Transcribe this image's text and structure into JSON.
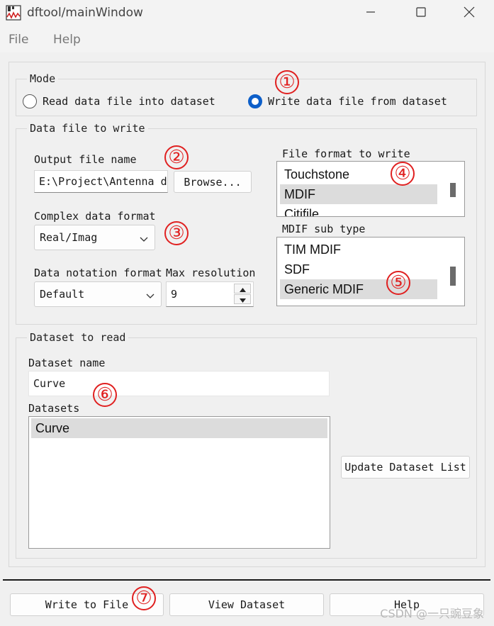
{
  "window": {
    "title": "dftool/mainWindow"
  },
  "menu": {
    "file": "File",
    "help": "Help"
  },
  "mode": {
    "legend": "Mode",
    "read_label": "Read data file into dataset",
    "write_label": "Write data file from dataset",
    "selected": "write"
  },
  "write_group": {
    "legend": "Data file to write",
    "output_label": "Output file name",
    "output_value": "E:\\Project\\Antenna design",
    "browse_label": "Browse...",
    "complex_label": "Complex data format",
    "complex_value": "Real/Imag",
    "notation_label": "Data notation format",
    "notation_value": "Default",
    "maxres_label": "Max resolution",
    "maxres_value": "9",
    "format_label": "File format to write",
    "format_items": [
      "Touchstone",
      "MDIF",
      "Citifile"
    ],
    "format_selected": 1,
    "subtype_label": "MDIF sub type",
    "subtype_items": [
      "TIM MDIF",
      "SDF",
      "Generic MDIF"
    ],
    "subtype_selected": 2
  },
  "read_group": {
    "legend": "Dataset to read",
    "name_label": "Dataset name",
    "name_value": "Curve",
    "datasets_label": "Datasets",
    "datasets": [
      "Curve"
    ],
    "update_label": "Update Dataset List"
  },
  "footer": {
    "write_button": "Write to File",
    "view_button": "View Dataset",
    "help_button": "Help"
  },
  "annotations": [
    "①",
    "②",
    "③",
    "④",
    "⑤",
    "⑥",
    "⑦"
  ],
  "watermark": "CSDN @一只豌豆象",
  "colors": {
    "accent": "#0d5fc9",
    "annotation": "#e02020",
    "selection": "#dcdcdc"
  },
  "icons": {
    "app": "waveform-app-icon",
    "minimize": "minimize-icon",
    "maximize": "maximize-icon",
    "close": "close-icon"
  }
}
